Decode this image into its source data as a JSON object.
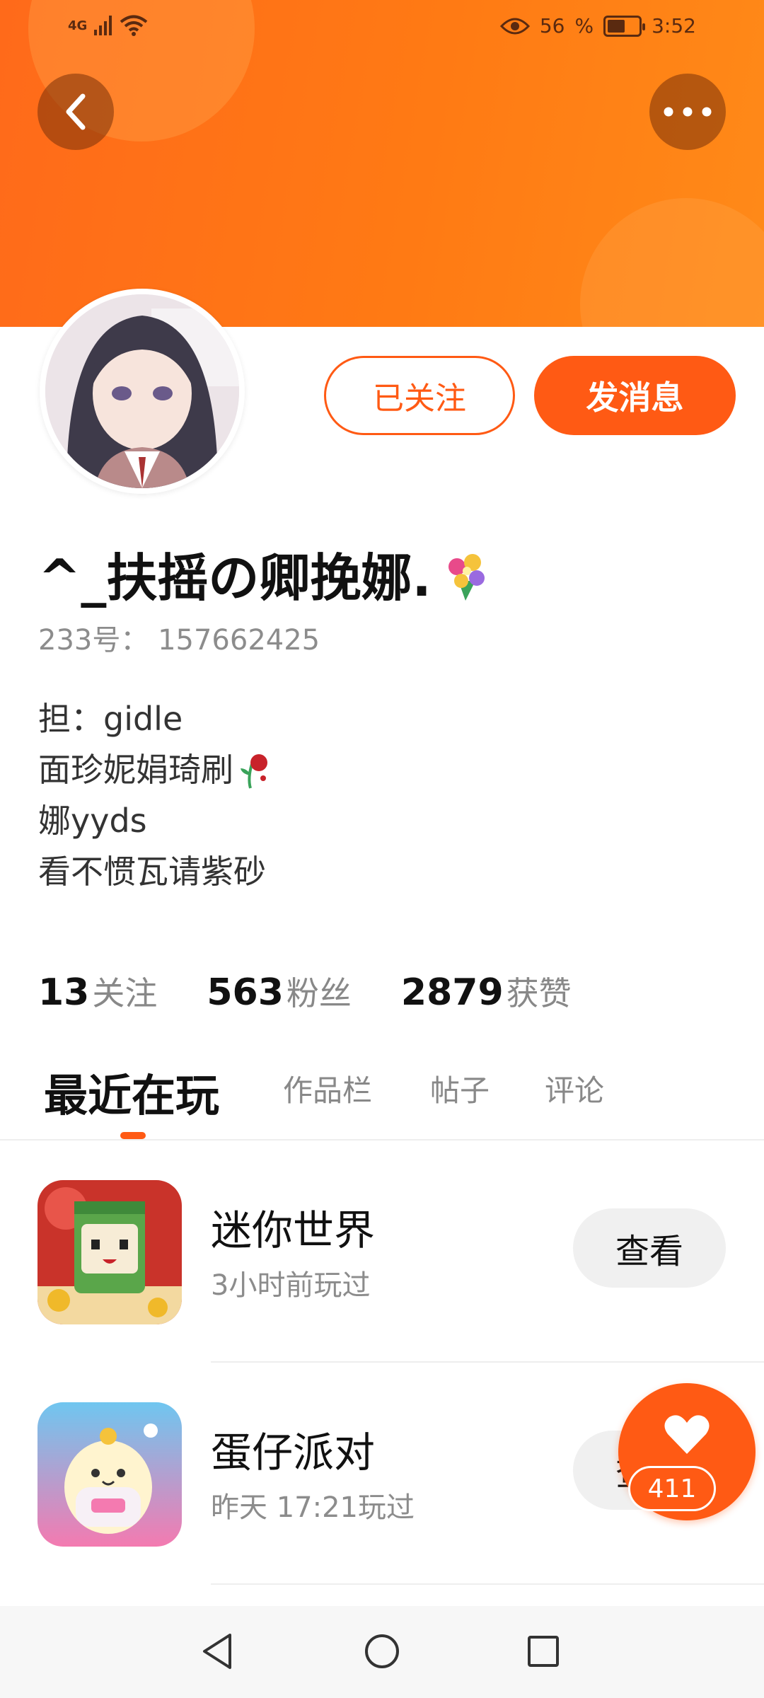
{
  "status_bar": {
    "network": "4G",
    "battery": "56",
    "time": "3:52",
    "battery_level": 0.56
  },
  "profile": {
    "name": "^_扶摇の卿挽娜.",
    "uid_label": "233号：",
    "uid": "157662425",
    "bio": [
      "担：gidle",
      "面珍妮娟琦刷",
      "娜yyds",
      "看不惯瓦请紫砂"
    ]
  },
  "actions": {
    "follow_label": "已关注",
    "message_label": "发消息"
  },
  "stats": [
    {
      "value": "13",
      "label": "关注"
    },
    {
      "value": "563",
      "label": "粉丝"
    },
    {
      "value": "2879",
      "label": "获赞"
    }
  ],
  "tabs": [
    "最近在玩",
    "作品栏",
    "帖子",
    "评论"
  ],
  "games": [
    {
      "title": "迷你世界",
      "subtitle": "3小时前玩过",
      "action": "查看"
    },
    {
      "title": "蛋仔派对",
      "subtitle": "昨天 17:21玩过",
      "action": "查看"
    }
  ],
  "like": {
    "count": "411"
  },
  "colors": {
    "accent": "#ff5a14",
    "header": "#ff7a14"
  }
}
